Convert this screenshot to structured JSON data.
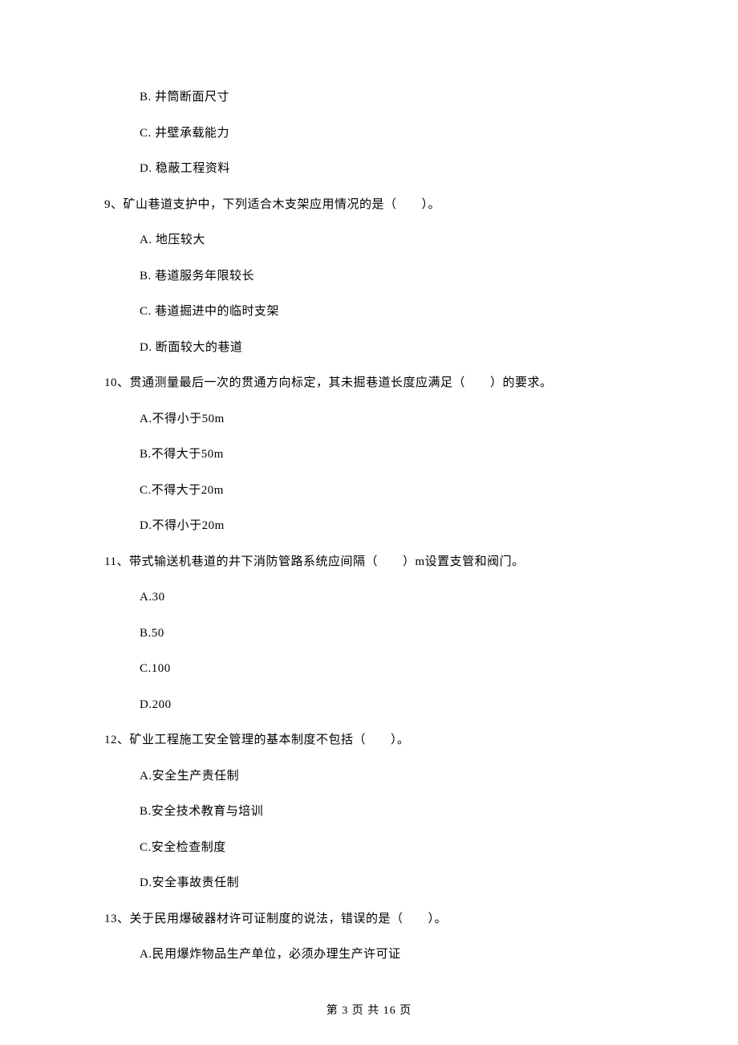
{
  "options_leading": [
    "B.  井筒断面尺寸",
    "C.  井壁承载能力",
    "D.  稳蔽工程资料"
  ],
  "q9": {
    "stem": "9、矿山巷道支护中，下列适合木支架应用情况的是（　　）。",
    "opts": [
      "A.  地压较大",
      "B.  巷道服务年限较长",
      "C.  巷道掘进中的临时支架",
      "D.  断面较大的巷道"
    ]
  },
  "q10": {
    "stem": "10、贯通测量最后一次的贯通方向标定，其未掘巷道长度应满足（　　）的要求。",
    "opts": [
      "A.不得小于50m",
      "B.不得大于50m",
      "C.不得大于20m",
      "D.不得小于20m"
    ]
  },
  "q11": {
    "stem": "11、带式输送机巷道的井下消防管路系统应间隔（　　）m设置支管和阀门。",
    "opts": [
      "A.30",
      "B.50",
      "C.100",
      "D.200"
    ]
  },
  "q12": {
    "stem": "12、矿业工程施工安全管理的基本制度不包括（　　）。",
    "opts": [
      "A.安全生产责任制",
      "B.安全技术教育与培训",
      "C.安全检查制度",
      "D.安全事故责任制"
    ]
  },
  "q13": {
    "stem": "13、关于民用爆破器材许可证制度的说法，错误的是（　　）。",
    "opts": [
      "A.民用爆炸物品生产单位，必须办理生产许可证"
    ]
  },
  "footer": "第 3 页 共 16 页"
}
